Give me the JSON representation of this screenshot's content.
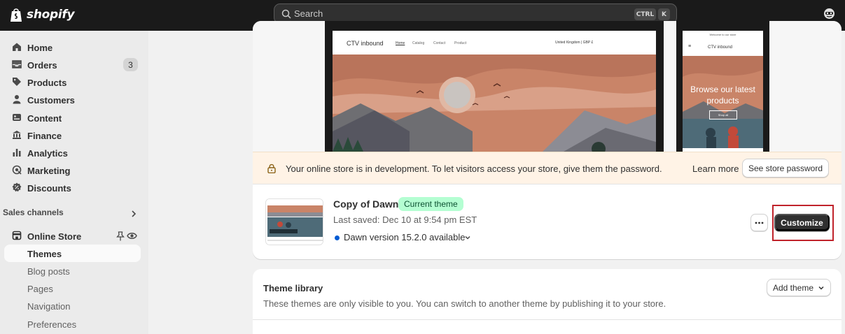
{
  "topbar": {
    "brand": "shopify",
    "search_placeholder": "Search",
    "shortcut_ctrl": "CTRL",
    "shortcut_k": "K"
  },
  "sidebar": {
    "items": [
      {
        "label": "Home",
        "icon": "home-icon"
      },
      {
        "label": "Orders",
        "icon": "inbox-icon",
        "badge": "3"
      },
      {
        "label": "Products",
        "icon": "tag-icon"
      },
      {
        "label": "Customers",
        "icon": "person-icon"
      },
      {
        "label": "Content",
        "icon": "content-icon"
      },
      {
        "label": "Finance",
        "icon": "bank-icon"
      },
      {
        "label": "Analytics",
        "icon": "bar-chart-icon"
      },
      {
        "label": "Marketing",
        "icon": "target-icon"
      },
      {
        "label": "Discounts",
        "icon": "discount-icon"
      }
    ],
    "sales_channels_label": "Sales channels",
    "online_store_label": "Online Store",
    "sub_items": [
      "Themes",
      "Blog posts",
      "Pages",
      "Navigation",
      "Preferences"
    ]
  },
  "preview": {
    "desktop_brand": "CTV inbound",
    "desktop_links": [
      "Home",
      "Catalog",
      "Contact",
      "Product"
    ],
    "desktop_region": "United Kingdom | GBP £",
    "mobile_top": "Welcome to our store",
    "mobile_brand": "CTV inbound",
    "mobile_heading": "Browse our latest products",
    "mobile_button": "Shop all"
  },
  "banner": {
    "message": "Your online store is in development. To let visitors access your store, give them the password.",
    "learn_more": "Learn more",
    "button": "See store password"
  },
  "current_theme": {
    "name": "Copy of Dawn",
    "badge": "Current theme",
    "last_saved": "Last saved: Dec 10 at 9:54 pm EST",
    "version": "Dawn version 15.2.0 available",
    "customize_label": "Customize"
  },
  "library": {
    "title": "Theme library",
    "description": "These themes are only visible to you. You can switch to another theme by publishing it to your store.",
    "add_button": "Add theme"
  },
  "colors": {
    "topbar": "#1a1a1a",
    "badge_green": "#b4fed2",
    "highlight_red": "#c0232b",
    "banner_bg": "#fff3e6",
    "dot_blue": "#005bd3"
  }
}
